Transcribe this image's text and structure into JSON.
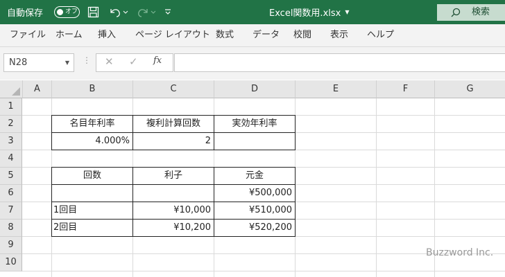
{
  "titlebar": {
    "autosave_label": "自動保存",
    "autosave_state": "オフ",
    "filename": "Excel関数用.xlsx",
    "search_label": "検索"
  },
  "ribbon": {
    "tabs": [
      "ファイル",
      "ホーム",
      "挿入",
      "ページ レイアウト",
      "数式",
      "データ",
      "校閲",
      "表示",
      "ヘルプ"
    ]
  },
  "formula_bar": {
    "name_box": "N28",
    "fx": "fx",
    "content": ""
  },
  "grid": {
    "columns": [
      "A",
      "B",
      "C",
      "D",
      "E",
      "F",
      "G"
    ],
    "rows": [
      "1",
      "2",
      "3",
      "4",
      "5",
      "6",
      "7",
      "8",
      "9",
      "10"
    ]
  },
  "table1": {
    "headers": [
      "名目年利率",
      "複利計算回数",
      "実効年利率"
    ],
    "values": [
      "4.000%",
      "2",
      ""
    ]
  },
  "table2": {
    "headers": [
      "回数",
      "利子",
      "元金"
    ],
    "rows": [
      [
        "",
        "",
        "¥500,000"
      ],
      [
        "1回目",
        "¥10,000",
        "¥510,000"
      ],
      [
        "2回目",
        "¥10,200",
        "¥520,200"
      ]
    ]
  },
  "watermark": "Buzzword Inc."
}
